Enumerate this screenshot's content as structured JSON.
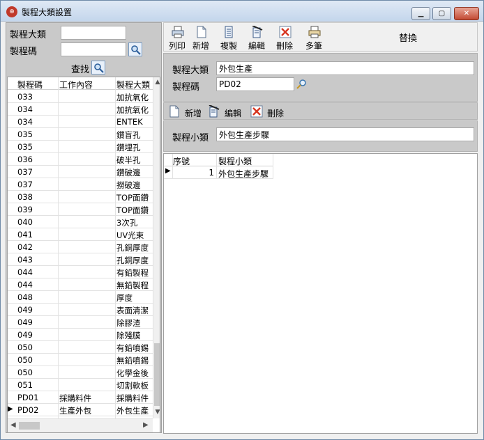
{
  "window": {
    "title": "製程大類設置",
    "icon": "app-globe-icon"
  },
  "left": {
    "label_category": "製程大類",
    "label_code": "製程碼",
    "category_value": "",
    "code_value": "",
    "search_label": "查找",
    "columns": [
      "製程碼",
      "工作內容",
      "製程大類"
    ],
    "rows": [
      {
        "code": "033",
        "work": "",
        "cat": "加抗氧化"
      },
      {
        "code": "034",
        "work": "",
        "cat": "加抗氧化"
      },
      {
        "code": "034",
        "work": "",
        "cat": "ENTEK"
      },
      {
        "code": "035",
        "work": "",
        "cat": "鑽盲孔"
      },
      {
        "code": "035",
        "work": "",
        "cat": "鑽埋孔"
      },
      {
        "code": "036",
        "work": "",
        "cat": "破半孔"
      },
      {
        "code": "037",
        "work": "",
        "cat": "鑽破邊"
      },
      {
        "code": "037",
        "work": "",
        "cat": "撈破邊"
      },
      {
        "code": "038",
        "work": "",
        "cat": "TOP面鑽"
      },
      {
        "code": "039",
        "work": "",
        "cat": "TOP面鑽"
      },
      {
        "code": "040",
        "work": "",
        "cat": "3次孔"
      },
      {
        "code": "041",
        "work": "",
        "cat": "UV光束"
      },
      {
        "code": "042",
        "work": "",
        "cat": "孔銅厚度"
      },
      {
        "code": "043",
        "work": "",
        "cat": "孔銅厚度"
      },
      {
        "code": "044",
        "work": "",
        "cat": "有鉛製程"
      },
      {
        "code": "044",
        "work": "",
        "cat": "無鉛製程"
      },
      {
        "code": "048",
        "work": "",
        "cat": "厚度"
      },
      {
        "code": "049",
        "work": "",
        "cat": "表面清潔"
      },
      {
        "code": "049",
        "work": "",
        "cat": "除膠渣"
      },
      {
        "code": "049",
        "work": "",
        "cat": "除殘膜"
      },
      {
        "code": "050",
        "work": "",
        "cat": "有鉛噴錫"
      },
      {
        "code": "050",
        "work": "",
        "cat": "無鉛噴錫"
      },
      {
        "code": "050",
        "work": "",
        "cat": "化學金後"
      },
      {
        "code": "051",
        "work": "",
        "cat": "切割軟板"
      },
      {
        "code": "PD01",
        "work": "採購料件",
        "cat": "採購料件"
      },
      {
        "code": "PD02",
        "work": "生產外包",
        "cat": "外包生產",
        "selected": true
      }
    ]
  },
  "toolbar": {
    "print": "列印",
    "new": "新增",
    "copy": "複製",
    "edit": "編輯",
    "delete": "刪除",
    "multi": "多筆",
    "replace": "替換"
  },
  "form1": {
    "label_category": "製程大類",
    "category_value": "外包生產",
    "label_code": "製程碼",
    "code_value": "PD02"
  },
  "toolbar2": {
    "new": "新增",
    "edit": "編輯",
    "delete": "刪除"
  },
  "form2": {
    "label_sub": "製程小類",
    "sub_value": "外包生產步驟"
  },
  "detail": {
    "columns": [
      "序號",
      "製程小類"
    ],
    "rows": [
      {
        "seq": "1",
        "sub": "外包生產步驟"
      }
    ]
  },
  "colors": {
    "panel": "#c9c9c9",
    "title_bar": "#c4d6ec",
    "close": "#c34a33"
  }
}
